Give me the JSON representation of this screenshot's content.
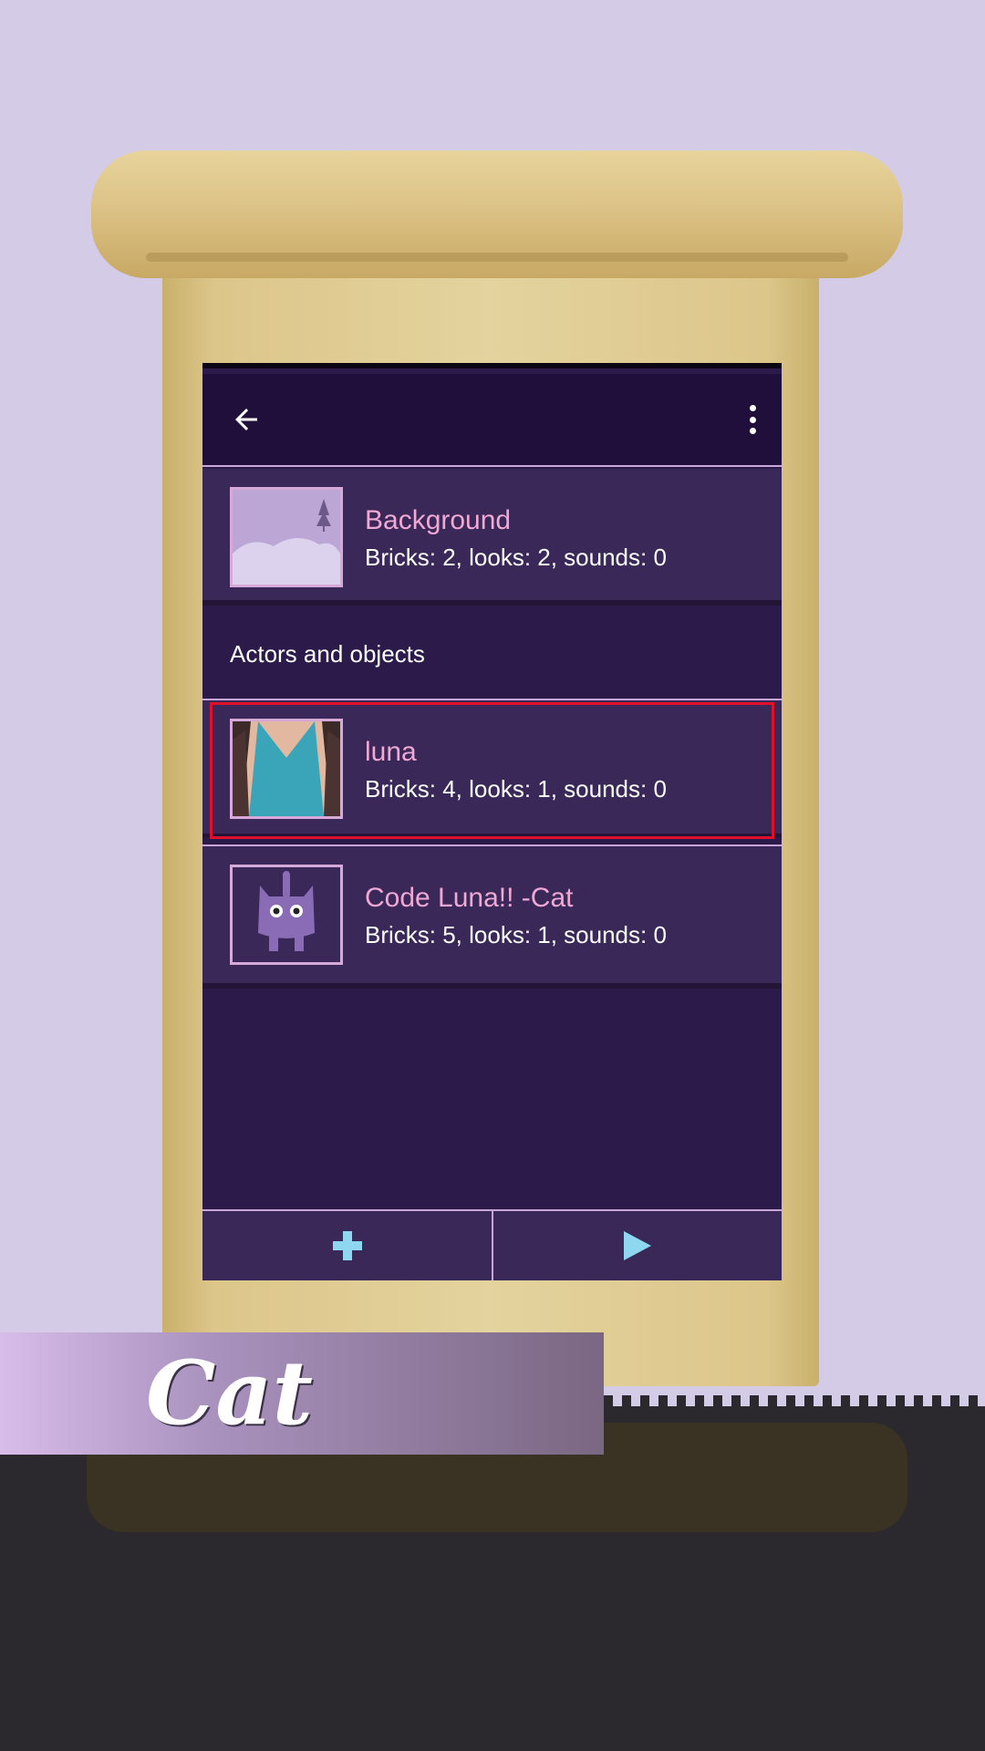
{
  "header": {
    "back_icon": "arrow-left-icon",
    "more_icon": "more-vert-icon"
  },
  "background_item": {
    "name": "Background",
    "details": "Bricks: 2, looks: 2, sounds: 0"
  },
  "section": {
    "label": "Actors and objects"
  },
  "objects": [
    {
      "name": "luna",
      "details": "Bricks: 4, looks: 1, sounds: 0",
      "selected": true
    },
    {
      "name": "Code Luna!! -Cat",
      "details": "Bricks: 5, looks: 1, sounds: 0",
      "selected": false
    }
  ],
  "bottom_bar": {
    "add_icon": "plus-icon",
    "play_icon": "play-icon"
  },
  "caption": {
    "text": "Cat"
  },
  "colors": {
    "accent_name": "#f0a8d4",
    "icon_blue": "#8fd6f0",
    "highlight": "#e0102c"
  }
}
